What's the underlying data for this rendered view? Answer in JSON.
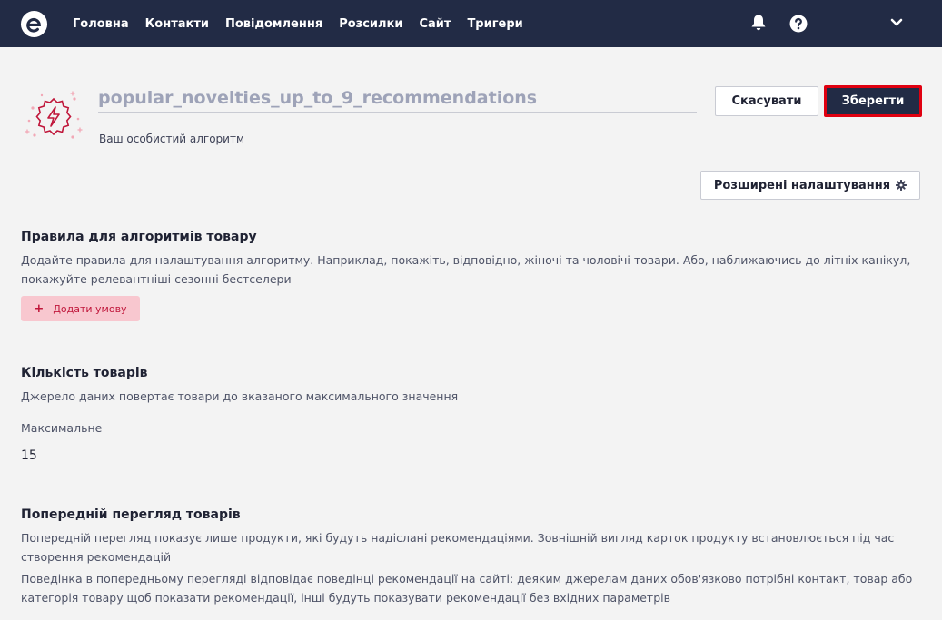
{
  "nav": {
    "items": [
      "Головна",
      "Контакти",
      "Повідомлення",
      "Розсилки",
      "Сайт",
      "Тригери"
    ]
  },
  "header": {
    "algorithm_name": "popular_novelties_up_to_9_recommendations",
    "subtitle": "Ваш особистий алгоритм",
    "cancel_label": "Скасувати",
    "save_label": "Зберегти",
    "advanced_label": "Розширені налаштування"
  },
  "rules": {
    "title": "Правила для алгоритмів товару",
    "description": "Додайте правила для налаштування алгоритму. Наприклад, покажіть, відповідно, жіночі та чоловічі товари. Або, наближаючись до літніх канікул, покажуйте релевантніші сезонні бестселери",
    "add_label": "Додати умову"
  },
  "quantity": {
    "title": "Кількість товарів",
    "description": "Джерело даних повертає товари до вказаного максимального значення",
    "max_label": "Максимальне",
    "max_value": "15"
  },
  "preview": {
    "title": "Попередній перегляд товарів",
    "description1": "Попередній перегляд показує лише продукти, які будуть надіслані рекомендаціями. Зовнішній вигляд карток продукту встановлюється під час створення рекомендацій",
    "description2": "Поведінка в попередньому перегляді відповідає поведінці рекомендації на сайті: деяким джерелам даних обов'язково потрібні контакт, товар або категорія товару щоб показати рекомендації, інші будуть показувати рекомендації без вхідних параметрів"
  },
  "colors": {
    "navbar": "#222b45",
    "highlight_border": "#e00010",
    "add_button_bg": "#f8c7cf",
    "brand_red": "#c0173b"
  },
  "icons": [
    "logo-icon",
    "bell-icon",
    "help-icon",
    "chevron-down-icon",
    "lightning-badge-icon",
    "gear-icon",
    "plus-icon"
  ]
}
